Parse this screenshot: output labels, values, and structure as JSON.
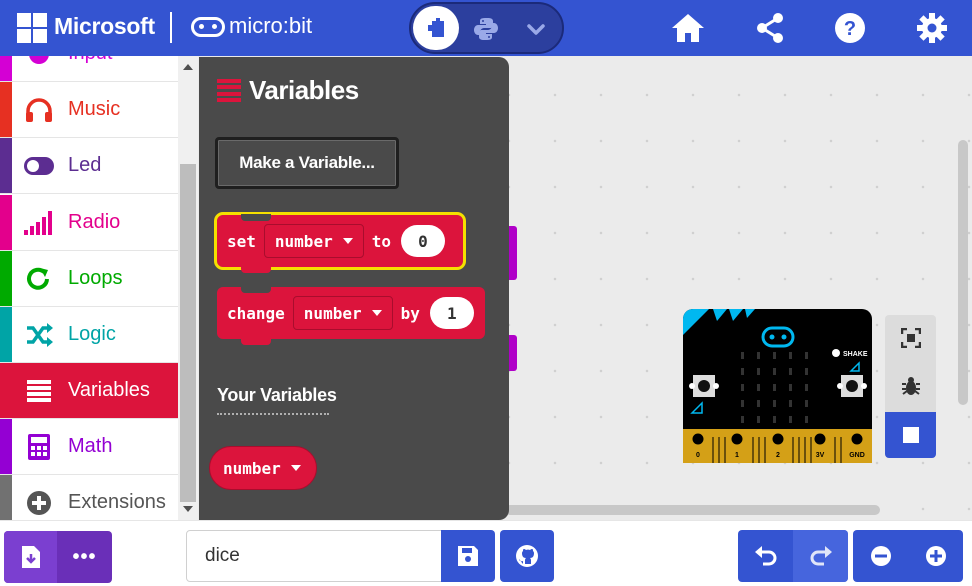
{
  "header": {
    "brand_microsoft": "Microsoft",
    "brand_product": "micro:bit",
    "icons": [
      "home-icon",
      "share-icon",
      "help-icon",
      "settings-icon"
    ]
  },
  "editor_toggle": {
    "active": "blocks",
    "options": [
      "blocks-icon",
      "python-icon",
      "chevron-down-icon"
    ]
  },
  "toolbox": {
    "items": [
      {
        "label": "Input",
        "color": "#d400d4",
        "icon": "input-icon"
      },
      {
        "label": "Music",
        "color": "#e63022",
        "icon": "headphones-icon"
      },
      {
        "label": "Led",
        "color": "#5c2d91",
        "icon": "toggle-icon"
      },
      {
        "label": "Radio",
        "color": "#e3008c",
        "icon": "signal-bars-icon"
      },
      {
        "label": "Loops",
        "color": "#00aa00",
        "icon": "loop-arrow-icon"
      },
      {
        "label": "Logic",
        "color": "#00a4a6",
        "icon": "shuffle-icon"
      },
      {
        "label": "Variables",
        "color": "#dc143c",
        "icon": "list-icon",
        "selected": true
      },
      {
        "label": "Math",
        "color": "#9400d3",
        "icon": "calculator-icon"
      },
      {
        "label": "Extensions",
        "color": "#717171",
        "icon": "plus-circle-icon"
      }
    ]
  },
  "flyout": {
    "title": "Variables",
    "make_variable_label": "Make a Variable...",
    "set_block": {
      "keyword": "set",
      "variable": "number",
      "connector": "to",
      "value": "0"
    },
    "change_block": {
      "keyword": "change",
      "variable": "number",
      "connector": "by",
      "value": "1"
    },
    "your_variables_heading": "Your Variables",
    "variable_pill": "number"
  },
  "simulator": {
    "pin_labels": [
      "0",
      "1",
      "2",
      "3V",
      "GND"
    ],
    "shake_label": "SHAKE",
    "controls": [
      "fullscreen-icon",
      "debug-bug-icon",
      "stop-icon"
    ]
  },
  "bottom_bar": {
    "project_name": "dice",
    "more_label": "•••"
  },
  "colors": {
    "header_blue": "#3454d1",
    "variables_red": "#dc143c",
    "flyout_bg": "#4a4a4a",
    "download_purple": "#7b3fd0"
  }
}
